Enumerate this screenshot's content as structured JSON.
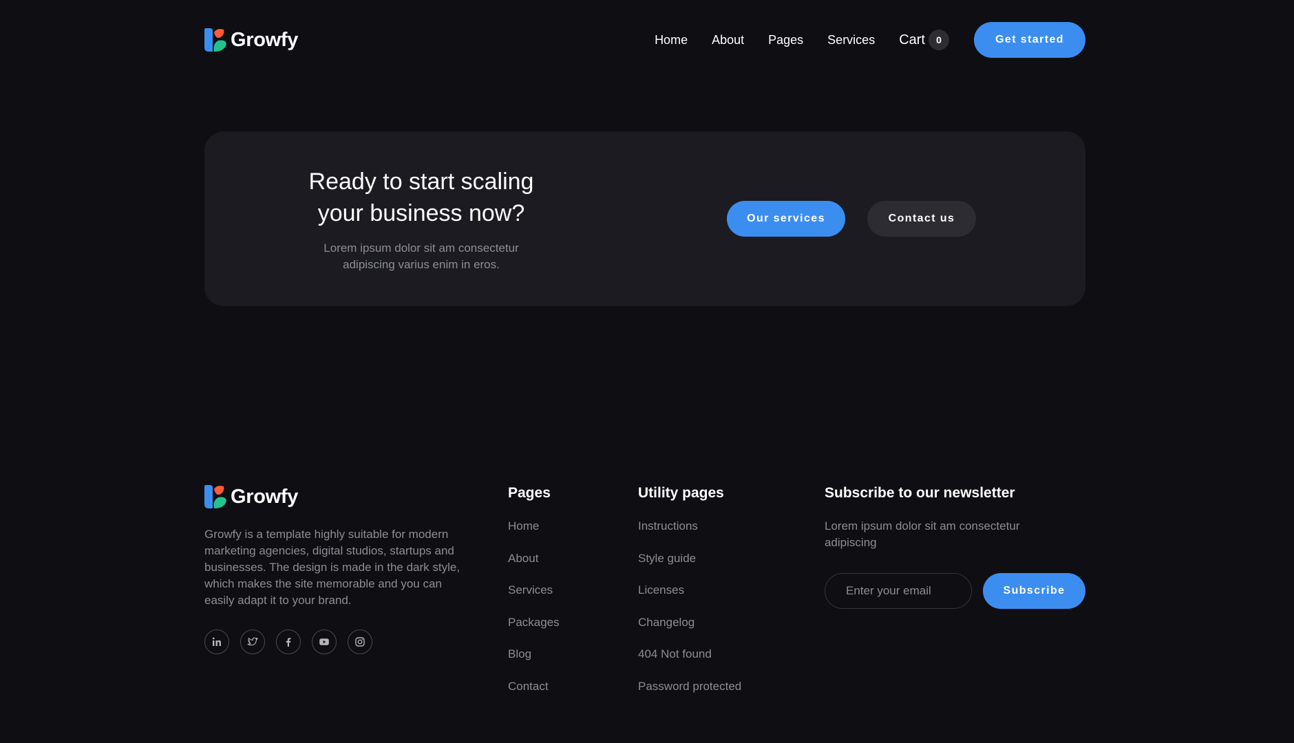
{
  "brand": {
    "name": "Growfy",
    "colors": {
      "blue": "#3b8ef0",
      "orange": "#ff5a3a",
      "green": "#22c38e"
    }
  },
  "header": {
    "nav": [
      {
        "label": "Home"
      },
      {
        "label": "About"
      },
      {
        "label": "Pages"
      },
      {
        "label": "Services"
      }
    ],
    "cart": {
      "label": "Cart",
      "count": "0"
    },
    "cta_label": "Get started"
  },
  "cta": {
    "title_line1": "Ready to start scaling",
    "title_line2": "your business now?",
    "subtitle_line1": "Lorem ipsum dolor sit am consectetur",
    "subtitle_line2": "adipiscing varius enim in eros.",
    "primary_label": "Our services",
    "secondary_label": "Contact us"
  },
  "footer": {
    "description": "Growfy is a template highly suitable for modern marketing agencies, digital studios, startups and businesses. The design is made in the dark style, which makes the site memorable and you can easily adapt it to your brand.",
    "socials": [
      {
        "icon": "linkedin-icon"
      },
      {
        "icon": "twitter-icon"
      },
      {
        "icon": "facebook-icon"
      },
      {
        "icon": "youtube-icon"
      },
      {
        "icon": "instagram-icon"
      }
    ],
    "pages": {
      "title": "Pages",
      "links": [
        "Home",
        "About",
        "Services",
        "Packages",
        "Blog",
        "Contact"
      ]
    },
    "utility": {
      "title": "Utility pages",
      "links": [
        "Instructions",
        "Style guide",
        "Licenses",
        "Changelog",
        "404 Not found",
        "Password protected"
      ]
    },
    "newsletter": {
      "title": "Subscribe to our newsletter",
      "description": "Lorem ipsum dolor sit am consectetur adipiscing",
      "email_placeholder": "Enter your email",
      "button_label": "Subscribe"
    }
  },
  "colors": {
    "background": "#0e0e13",
    "card": "#1b1b21",
    "accent": "#3b8ef0",
    "muted_text": "#8c8c95"
  }
}
